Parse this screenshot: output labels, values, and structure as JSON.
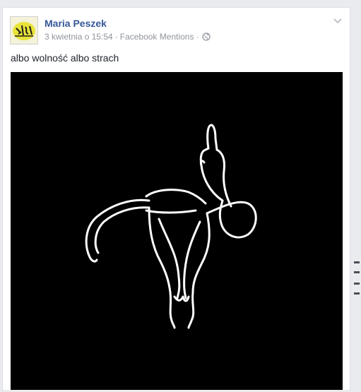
{
  "post": {
    "author": "Maria Peszek",
    "timestamp": "3 kwietnia o 15:54",
    "separator": "·",
    "source": "Facebook Mentions",
    "text": "albo wolność albo strach"
  },
  "colors": {
    "author_link": "#365899",
    "meta": "#90949c",
    "image_background": "#000000",
    "artwork_line": "#ffffff",
    "avatar_accent": "#e8e33a"
  },
  "icons": {
    "privacy": "globe-icon",
    "menu": "chevron-down-icon"
  }
}
